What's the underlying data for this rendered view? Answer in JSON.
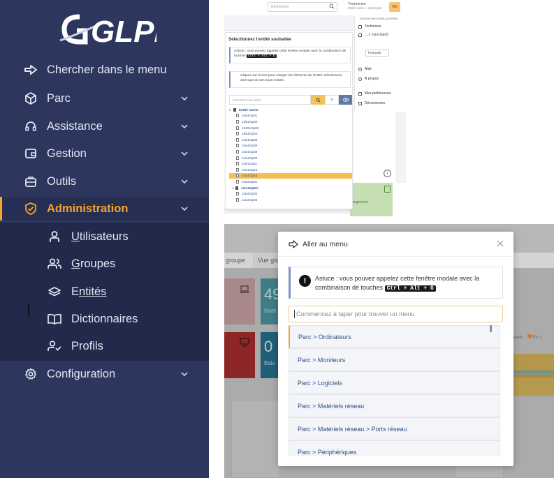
{
  "sidebar": {
    "logo_text": "GLPI",
    "search_label": "Chercher dans le menu",
    "items": [
      {
        "label": "Parc"
      },
      {
        "label": "Assistance"
      },
      {
        "label": "Gestion"
      },
      {
        "label": "Outils"
      },
      {
        "label": "Administration"
      },
      {
        "label": "Configuration"
      }
    ],
    "submenu": [
      {
        "first": "U",
        "rest": "tilisateurs"
      },
      {
        "first": "G",
        "rest": "roupes"
      },
      {
        "first": "E",
        "rest": "ntités"
      },
      {
        "first": "D",
        "rest": "ictionnaires"
      },
      {
        "first": "P",
        "rest": "rofils"
      }
    ],
    "accent_color": "#f6a32e",
    "bg_color": "#2d375d"
  },
  "top_shot": {
    "search_placeholder": "Rechercher",
    "user_role": "Technicien",
    "user_entity": "Entité racine > 1sio1Gp15",
    "user_badge": "NU",
    "modal_title": "Sélectionnez l'entité souhaitée",
    "alert1_text": "Astuce : vous pouvez appelez cette fenêtre modale avec la combinaison de touches",
    "alert1_kbd": "Ctrl + Alt + E",
    "alert2_text": "Cliquez sur l'icône pour charger les éléments de l'entité sélectionnée ainsi que de ses sous-entités.",
    "search_placeholder2": "Cherchez une entité",
    "tree_root": "Entité racine",
    "tree_items": [
      "1sio1Gp01",
      "1sio1Gp02",
      "1SIO1Gp03",
      "1sio1Gp04",
      "1sio1Gp05",
      "1sio1Gp06",
      "1sio1Gp08",
      "1sio1Gp09",
      "1sio1Gp11",
      "1sio1Gp13",
      "1sio1Gp15",
      "1sio2Gp01",
      "1sio2Gp02",
      "1sio2Gp03"
    ],
    "tree_selected_index": 10,
    "tree_group": "1sio2GpEU",
    "dropdown": {
      "user_name": "JORDAN MACVADELA1HERBA",
      "profile": "Technicien",
      "entity": "... > 1sio1Gp15",
      "language": "Français",
      "help": "Aide",
      "about": "À propos",
      "prefs": "Mes préférences",
      "logout": "Déconnexion"
    },
    "tile_label": "angement"
  },
  "bot_shot": {
    "tab1": "groupe",
    "tab2": "Vue glo",
    "tile1_num": "49",
    "tile1_sub": "Mate",
    "tile2_num": "0",
    "tile2_sub": "Bale",
    "legend_text": "uveau",
    "legend_text2": "En c"
  },
  "goto_modal": {
    "title": "Aller au menu",
    "alert_text": "Astuce : vous pouvez appelez cette fenêtre modale avec la combinaison de touches",
    "alert_kbd": "Ctrl + Alt + G",
    "input_placeholder": "Commencez à taper pour trouver un menu",
    "items": [
      "Parc > Ordinateurs",
      "Parc > Moniteurs",
      "Parc > Logiciels",
      "Parc > Matériels réseau",
      "Parc > Matériels réseau > Ports réseau",
      "Parc > Périphériques"
    ]
  }
}
